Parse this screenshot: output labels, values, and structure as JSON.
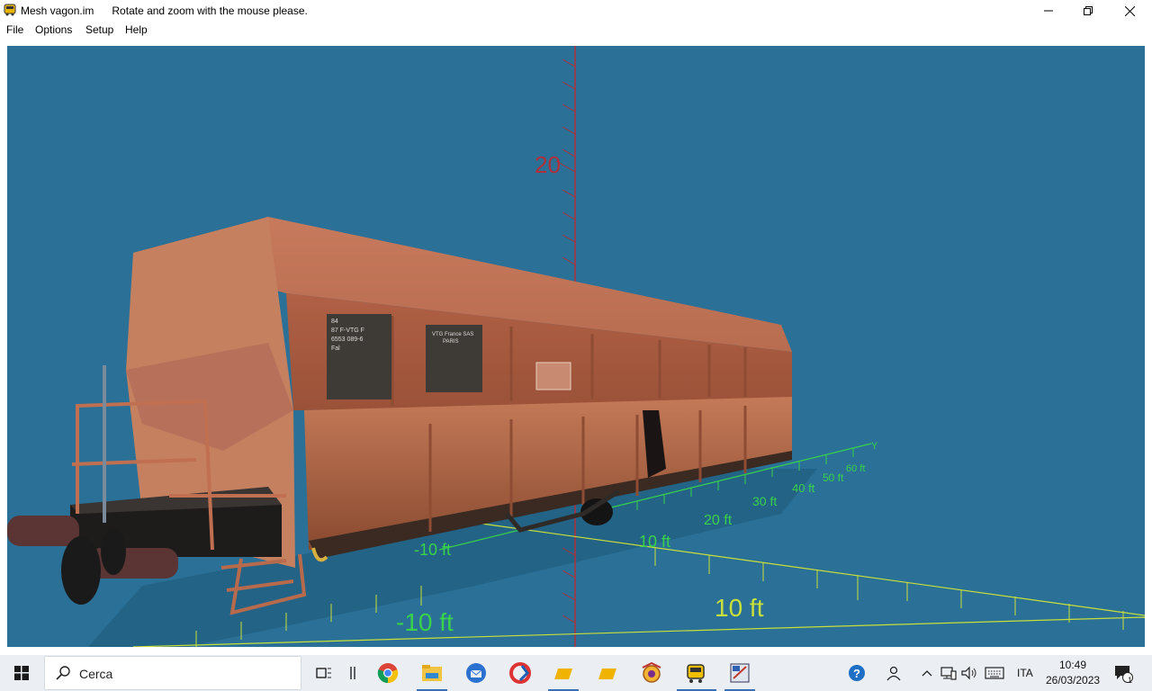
{
  "window": {
    "title": "Mesh vagon.im",
    "message": "Rotate and zoom with the mouse please."
  },
  "menu": {
    "items": [
      "File",
      "Options",
      "Setup",
      "Help"
    ]
  },
  "viewport": {
    "background": "#2a7097",
    "wagon_color": "#c98060",
    "vertical_axis_label": "20",
    "x_axis_labels": [
      "-10 ft",
      "10 ft"
    ],
    "y_axis_labels": [
      "-10 ft",
      "10 ft",
      "20 ft",
      "30 ft",
      "40 ft",
      "50 ft",
      "60 ft"
    ],
    "y_axis_name": "Y",
    "wagon_texts": [
      "84",
      "87  F-VTG F",
      "6553 089-6",
      "Fal",
      "VTG France SAS",
      "PARIS"
    ]
  },
  "taskbar": {
    "search_placeholder": "Cerca",
    "icons": [
      "task-view-icon",
      "chrome-icon",
      "file-explorer-icon",
      "thunderbird-icon",
      "ccleaner-icon",
      "folder-icon",
      "folder-icon-2",
      "game-icon",
      "train-app-icon",
      "mesh-editor-icon"
    ],
    "tray": {
      "language": "ITA",
      "time": "10:49",
      "date": "26/03/2023",
      "notification_count": "1"
    }
  }
}
